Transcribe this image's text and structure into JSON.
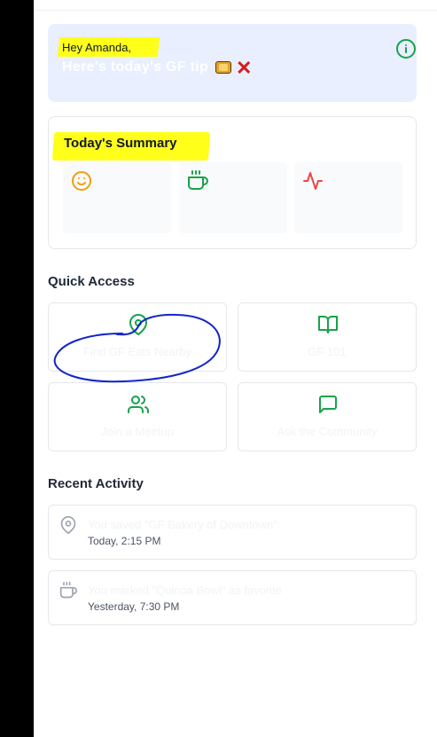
{
  "colors": {
    "green": "#16a34a",
    "orange": "#f59e0b",
    "red": "#ef4444",
    "gray_icon": "#9ca3af",
    "highlight": "#ffff1a",
    "scribble": "#1226c8"
  },
  "greeting": "Hey Amanda,",
  "tip": {
    "text": "Here's today's GF tip",
    "emojis": [
      "bread-emoji",
      "cross-mark-emoji"
    ]
  },
  "summary": {
    "title": "Today's Summary",
    "tiles": [
      {
        "icon": "smile-icon"
      },
      {
        "icon": "coffee-cup-icon"
      },
      {
        "icon": "activity-pulse-icon"
      }
    ]
  },
  "quick_access": {
    "title": "Quick Access",
    "items": [
      {
        "label": "Find GF Eats Nearby",
        "icon": "map-pin-icon"
      },
      {
        "label": "GF 101",
        "icon": "book-open-icon"
      },
      {
        "label": "Join a Meetup",
        "icon": "users-icon"
      },
      {
        "label": "Ask the Community",
        "icon": "message-square-icon"
      }
    ]
  },
  "recent_activity": {
    "title": "Recent Activity",
    "items": [
      {
        "icon": "map-pin-icon",
        "text": "You saved \"GF Bakery of Downtown\"",
        "time": "Today, 2:15 PM"
      },
      {
        "icon": "coffee-cup-icon",
        "text": "You marked \"Quinoa Bowl\" as favorite",
        "time": "Yesterday, 7:30 PM"
      }
    ]
  }
}
